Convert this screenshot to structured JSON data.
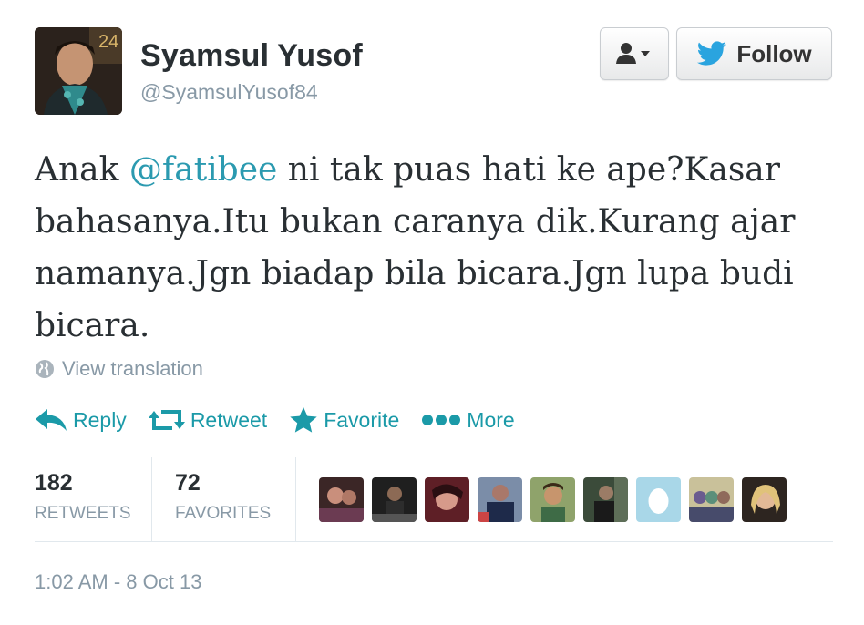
{
  "user": {
    "name": "Syamsul Yusof",
    "handle": "@SyamsulYusof84",
    "avatar_icon": "profile-photo"
  },
  "buttons": {
    "user_menu_icon": "person-dropdown-icon",
    "follow_label": "Follow",
    "follow_icon": "twitter-bird-icon"
  },
  "tweet": {
    "prefix": "Anak ",
    "mention": "@fatibee",
    "body": " ni tak puas hati ke ape?Kasar bahasanya.Itu bukan caranya dik.Kurang ajar namanya.Jgn biadap bila bicara.Jgn lupa budi bicara."
  },
  "translate": {
    "label": "View translation",
    "icon": "globe-icon"
  },
  "actions": [
    {
      "label": "Reply",
      "icon": "reply-icon"
    },
    {
      "label": "Retweet",
      "icon": "retweet-icon"
    },
    {
      "label": "Favorite",
      "icon": "star-icon"
    },
    {
      "label": "More",
      "icon": "more-dots-icon"
    }
  ],
  "stats": {
    "retweets": {
      "count": "182",
      "label": "RETWEETS"
    },
    "favorites": {
      "count": "72",
      "label": "FAVORITES"
    }
  },
  "favoriters_count": 9,
  "timestamp": "1:02 AM - 8 Oct 13",
  "colors": {
    "link": "#2b9ab0",
    "action": "#1b9aa8",
    "muted": "#8899a6",
    "follow_bird": "#2aa4df"
  }
}
